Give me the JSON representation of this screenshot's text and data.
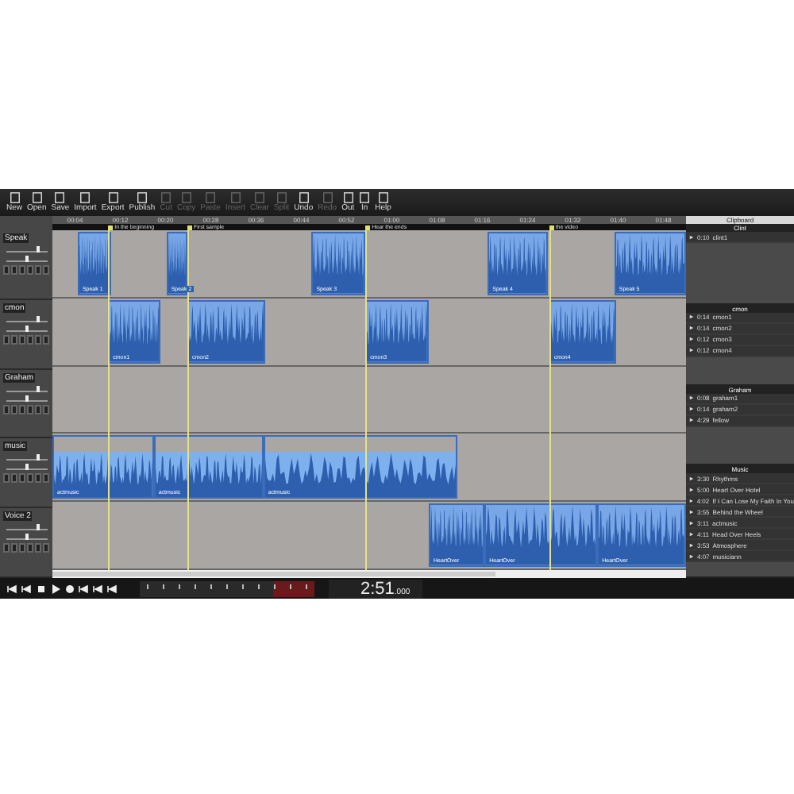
{
  "toolbar": [
    {
      "label": "New",
      "disabled": false
    },
    {
      "label": "Open",
      "disabled": false
    },
    {
      "label": "Save",
      "disabled": false
    },
    {
      "label": "Import",
      "disabled": false
    },
    {
      "label": "Export",
      "disabled": false
    },
    {
      "label": "Publish",
      "disabled": false
    },
    {
      "label": "Cut",
      "disabled": true
    },
    {
      "label": "Copy",
      "disabled": true
    },
    {
      "label": "Paste",
      "disabled": true
    },
    {
      "label": "Insert",
      "disabled": true
    },
    {
      "label": "Clear",
      "disabled": true
    },
    {
      "label": "Split",
      "disabled": true
    },
    {
      "label": "Undo",
      "disabled": false
    },
    {
      "label": "Redo",
      "disabled": true
    },
    {
      "label": "Out",
      "disabled": false
    },
    {
      "label": "In",
      "disabled": false
    },
    {
      "label": "Help",
      "disabled": false
    }
  ],
  "ruler": [
    "00:04",
    "00:12",
    "00:20",
    "00:28",
    "00:36",
    "00:44",
    "00:52",
    "01:00",
    "01:08",
    "01:16",
    "01:24",
    "01:32",
    "01:40",
    "01:48"
  ],
  "markers": [
    {
      "label": "In the beginning"
    },
    {
      "label": "First sample"
    },
    {
      "label": "Hear the ends"
    },
    {
      "label": "the video"
    }
  ],
  "tracks": [
    {
      "name": "Speak",
      "volume": {
        "level": 0.75
      },
      "pan": {
        "level": 0.5
      },
      "clips": [
        {
          "label": "Speak 1"
        },
        {
          "label": "Speak 2"
        },
        {
          "label": "Speak 3"
        },
        {
          "label": "Speak 4"
        },
        {
          "label": "Speak 5"
        }
      ]
    },
    {
      "name": "cmon",
      "volume": {
        "level": 0.75
      },
      "pan": {
        "level": 0.5
      },
      "clips": [
        {
          "label": "cmon1"
        },
        {
          "label": "cmon2"
        },
        {
          "label": "cmon3"
        },
        {
          "label": "cmon4"
        }
      ]
    },
    {
      "name": "Graham",
      "volume": {
        "level": 0.75
      },
      "pan": {
        "level": 0.5
      }
    },
    {
      "name": "music",
      "volume": {
        "level": 0.75
      },
      "pan": {
        "level": 0.5
      },
      "clips": [
        {
          "label": "actmusic"
        },
        {
          "label": "actmusic"
        },
        {
          "label": "actmusic"
        }
      ]
    },
    {
      "name": "Voice 2",
      "volume": {
        "level": 0.75
      },
      "pan": {
        "level": 0.5
      },
      "clips": [
        {
          "label": "HeartOver"
        },
        {
          "label": "HeartOver"
        },
        {
          "label": "HeartOver"
        }
      ]
    }
  ],
  "clipboard": {
    "title": "Clipboard",
    "sections": [
      {
        "title": "Clint",
        "items": [
          {
            "time": "0:10",
            "name": "clint1"
          }
        ]
      },
      {
        "title": "cmon",
        "items": [
          {
            "time": "0:14",
            "name": "cmon1"
          },
          {
            "time": "0:14",
            "name": "cmon2"
          },
          {
            "time": "0:12",
            "name": "cmon3"
          },
          {
            "time": "0:12",
            "name": "cmon4"
          }
        ]
      },
      {
        "title": "Graham",
        "items": [
          {
            "time": "0:08",
            "name": "graham1"
          },
          {
            "time": "0:14",
            "name": "graham2"
          },
          {
            "time": "4:29",
            "name": "fellow"
          }
        ]
      },
      {
        "title": "Music",
        "items": [
          {
            "time": "3:30",
            "name": "Rhythms"
          },
          {
            "time": "5:00",
            "name": "Heart Over Hotel"
          },
          {
            "time": "4:02",
            "name": "If I Can Lose My Faith In You"
          },
          {
            "time": "3:55",
            "name": "Behind the Wheel"
          },
          {
            "time": "3:11",
            "name": "actmusic"
          },
          {
            "time": "4:11",
            "name": "Head Over Heels"
          },
          {
            "time": "3:53",
            "name": "Atmosphere"
          },
          {
            "time": "4:07",
            "name": "musiciann"
          }
        ]
      }
    ]
  },
  "time": {
    "main": "2:51",
    "fraction": ".000"
  }
}
